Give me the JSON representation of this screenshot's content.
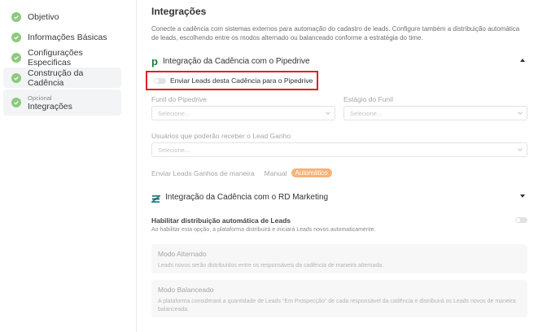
{
  "sidebar": {
    "items": [
      {
        "label": "Objetivo"
      },
      {
        "label": "Informações Básicas"
      },
      {
        "label": "Configurações Especificas"
      },
      {
        "label": "Construção da Cadência"
      },
      {
        "sublabel": "Opcional",
        "label": "Integrações"
      }
    ]
  },
  "main": {
    "title": "Integrações",
    "description": "Conecte a cadência com sistemas externos para automação do cadastro de leads. Configure também a distribuição automática de leads, escolhendo entre os modos alternado ou balanceado conforme a estratégia do time.",
    "pipedrive": {
      "logo": "p",
      "title": "Integração da Cadência com o Pipedrive",
      "toggle_label": "Enviar Leads desta Cadência para o Pipedrive",
      "funil_label": "Funil do Pipedrive",
      "funil_placeholder": "Selecione...",
      "estagio_label": "Estágio do Funil",
      "estagio_placeholder": "Selecione...",
      "usuarios_label": "Usuários que poderão receber o Lead Ganho",
      "usuarios_placeholder": "Selecione...",
      "modo_label": "Enviar Leads Ganhos de maneira",
      "modo_manual": "Manual",
      "modo_auto": "Automático"
    },
    "rd": {
      "title": "Integração da Cadência com o RD Marketing",
      "habilitar_title": "Habilitar distribuição automática de Leads",
      "habilitar_desc": "Ao habilitar esta opção, a plataforma distribuirá e iniciará Leads novos automaticamente.",
      "alternado_title": "Modo Alternado",
      "alternado_desc": "Leads novos serão distribuídos entre os responsáveis da cadência de maneira alternada.",
      "balanceado_title": "Modo Balanceado",
      "balanceado_desc": "A plataforma considerará a quantidade de Leads \"Em Prospecção\" de cada responsável da cadência e distribuirá os Leads novos de maneira balanceada."
    }
  },
  "colors": {
    "check": "#8cc97e",
    "accent": "#f5b37a",
    "pipedrive_green": "#1a7a3c",
    "highlight_red": "#e02020"
  }
}
